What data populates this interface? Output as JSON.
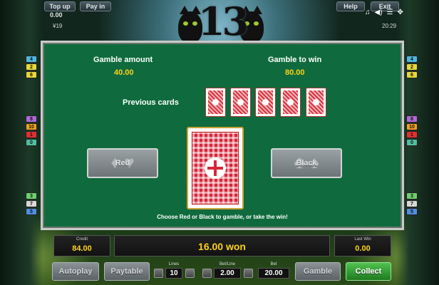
{
  "topbar": {
    "top_up_label": "Top up",
    "top_up_value": "0.00",
    "pay_in_label": "Pay in",
    "help_label": "Help",
    "exit_label": "Exit",
    "left_small": "¥19",
    "clock": "20:29"
  },
  "logo": {
    "number": "13"
  },
  "paylines": {
    "left_top": [
      "4",
      "2",
      "6"
    ],
    "left_mid": [
      "8",
      "10",
      "1",
      "0"
    ],
    "left_bot": [
      "3",
      "7",
      "5"
    ],
    "right_top": [
      "4",
      "2",
      "6"
    ],
    "right_mid": [
      "8",
      "10",
      "1",
      "0"
    ],
    "right_bot": [
      "3",
      "7",
      "5"
    ],
    "colors": {
      "4": "#4fb8e0",
      "2": "#e6d83a",
      "6": "#e6d83a",
      "8": "#b06ad6",
      "10": "#f0a020",
      "1": "#e03030",
      "0": "#4fbfa0",
      "3": "#6ed06e",
      "7": "#d8d8d8",
      "5": "#4f8fe0"
    }
  },
  "gamble": {
    "amount_label": "Gamble amount",
    "amount_value": "40.00",
    "to_win_label": "Gamble to win",
    "to_win_value": "80.00",
    "previous_label": "Previous cards",
    "red_label": "Red",
    "black_label": "Black",
    "hint": "Choose Red or Black to gamble, or take the win!"
  },
  "bottom": {
    "credit_label": "Credit",
    "credit_value": "84.00",
    "win_text": "16.00 won",
    "last_win_label": "Last Win",
    "last_win_value": "0.00",
    "autoplay_label": "Autoplay",
    "paytable_label": "Paytable",
    "lines_label": "Lines",
    "lines_value": "10",
    "bet_line_label": "Bet/Line",
    "bet_line_value": "2.00",
    "bet_label": "Bet",
    "bet_value": "20.00",
    "gamble_label": "Gamble",
    "collect_label": "Collect"
  }
}
